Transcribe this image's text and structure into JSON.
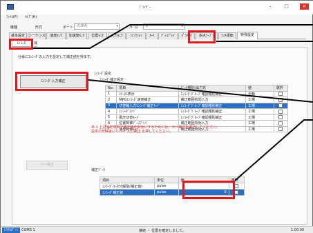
{
  "window": {
    "title": "ﾌﾞﾗｲｻﾞｰ"
  },
  "menubar": {
    "items": [
      "ﾌｧｲﾙ(F)",
      "ﾍﾙﾌﾟ(H)"
    ]
  },
  "toolbar": {
    "model_label": "機種",
    "format_label": "形式",
    "port_label": "ポート",
    "port_value": "(COM)",
    "unit_label": "ｱﾄﾞﾚｽ",
    "unit_value": "1"
  },
  "tabs": [
    "基本設定",
    "シーケンス",
    "速度ﾓﾆﾀ",
    "加速度ﾓﾆﾀ",
    "位置ﾓﾆﾀ",
    "入力ﾓﾆﾀ",
    "ﾌｧﾝｸｼｮﾝ",
    "ｵｰﾄ",
    "ﾃﾞｨｽﾌﾟﾚｲ",
    "ﾊﾟﾗﾒｰﾀ",
    "多点ﾃｰﾌﾞﾙ",
    "ﾃｽﾄ運転",
    "特殊設定"
  ],
  "subtabs": {
    "active": "ｴﾝｺｰﾀﾞ",
    "rest": "補正"
  },
  "content": {
    "description": "仕様にｴﾝｺｰﾀﾞの入力を設定して補正値を得ます。",
    "encoder_button": "ｴﾝｺｰﾀﾞ入力補正",
    "mid_button": "ﾘｾｯﾄ補正"
  },
  "setting_group": {
    "title": "ｴﾝｺｰﾀﾞ設定",
    "caption": "ｴﾝｺｰﾀﾞ補正設定",
    "columns": [
      "No.",
      "項目",
      "ﾃﾞｰﾀ種別/出力先",
      "値",
      "選択"
    ],
    "rows": [
      {
        "no": "1",
        "item": "ｽﾃｰﾀｽ表示",
        "src": "ｴﾝｺｰﾀﾞｸﾞﾙｰﾌﾟ確認種別補正",
        "val": "手動",
        "sel": false,
        "selected": false
      },
      {
        "no": "2",
        "item": "MPGｴﾝｺｰﾀﾞ速度補正",
        "src": "補正範囲有効入力",
        "val": "工場",
        "sel": false,
        "selected": false
      },
      {
        "no": "3",
        "item": "切替軸入力ｴﾝｺｰﾀﾞ補正ﾓｰﾄﾞ",
        "src": "ｴﾝｺｰﾀﾞｸﾞﾙｰﾌﾟ確認種別補正",
        "val": "工場",
        "sel": true,
        "selected": true
      },
      {
        "no": "4",
        "item": "ｴﾝｺｰﾀﾞｴｯｼﾞ",
        "src": "ｴﾝｺｰﾀﾞｸﾞﾙｰﾌﾟ確認種別補正",
        "val": "工場",
        "sel": false,
        "selected": false
      },
      {
        "no": "5",
        "item": "電圧切替ﾓｰﾄﾞ",
        "src": "ｴﾝｺｰﾀﾞｸﾞﾙｰﾌﾟ確認種別補正",
        "val": "工場",
        "sel": false,
        "selected": false
      },
      {
        "no": "6",
        "item": "位置制御ﾃﾞｨｽﾌﾟﾚｲ",
        "src": "補正範囲有効入力",
        "val": "工場",
        "sel": false,
        "selected": false
      },
      {
        "no": "7",
        "item": "速度制御ﾓｰﾄﾞ",
        "src": "補正範囲有効入力",
        "val": "工場",
        "sel": false,
        "selected": false
      }
    ]
  },
  "warning": "あ 1 上記設定項目で補正値を有効にするためには、ﾘｾｯﾄ補正を実行してください。\n設定の反映後に ｴﾝｺｰﾀﾞ入力補正 を押してください。",
  "target_group": {
    "title": "補正ﾃﾞｰﾀ",
    "columns": [
      "項目",
      "単位",
      "値",
      "選択"
    ],
    "rows": [
      {
        "item": "ｴﾝｺｰﾀﾞ/ﾓｰﾀ分解能(補正値)",
        "unit": "pulse",
        "val": "",
        "sel": false,
        "selected": false
      },
      {
        "item": "ｴﾝｺｰﾀﾞ補正値",
        "unit": "pulse",
        "val": "0",
        "sel": false,
        "selected": true
      }
    ]
  },
  "statusbar": {
    "port": "ｼﾘｱﾙﾎﾟｰﾄ",
    "port_value": "COM3  1",
    "message": "接続 ・ 位置を確定しました。",
    "number": "1.00.00"
  },
  "colors": {
    "accent": "#2b6fc2",
    "highlight": "#e0191f",
    "warning": "#d42a2a"
  }
}
